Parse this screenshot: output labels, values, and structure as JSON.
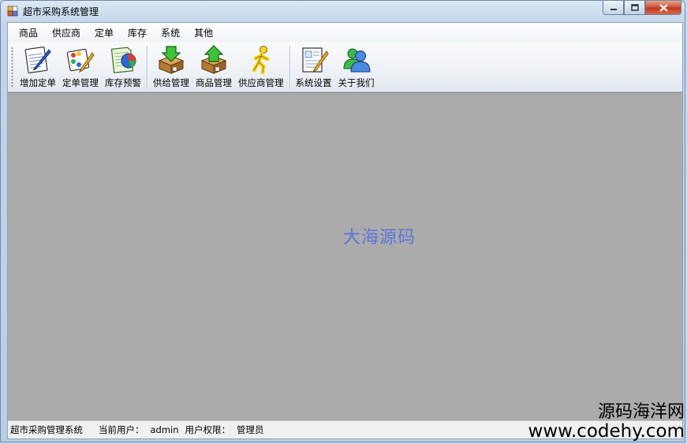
{
  "window": {
    "title": "超市采购系统管理"
  },
  "menu": [
    "商品",
    "供应商",
    "定单",
    "库存",
    "系统",
    "其他"
  ],
  "toolbar": {
    "groups": [
      [
        {
          "label": "增加定单",
          "icon": "notepad-pen-icon"
        },
        {
          "label": "定单管理",
          "icon": "palette-pencil-icon"
        },
        {
          "label": "库存预警",
          "icon": "pie-chart-document-icon"
        }
      ],
      [
        {
          "label": "供给管理",
          "icon": "box-arrow-down-icon"
        },
        {
          "label": "商品管理",
          "icon": "box-arrow-up-icon"
        },
        {
          "label": "供应商管理",
          "icon": "running-man-icon"
        }
      ],
      [
        {
          "label": "系统设置",
          "icon": "document-pencil-icon"
        },
        {
          "label": "关于我们",
          "icon": "users-icon"
        }
      ]
    ]
  },
  "mdi": {
    "watermark": "大海源码"
  },
  "status": {
    "app_name": "超市采购管理系统",
    "user_label": "当前用户：",
    "user_value": "admin",
    "role_label": "用户权限：",
    "role_value": "管理员"
  },
  "overlay": {
    "brand_cn": "源码海洋网",
    "brand_url": "www.codehy.com"
  },
  "colors": {
    "mdi_background": "#ababab",
    "watermark": "#5b74d8",
    "close_button": "#c1381c"
  }
}
